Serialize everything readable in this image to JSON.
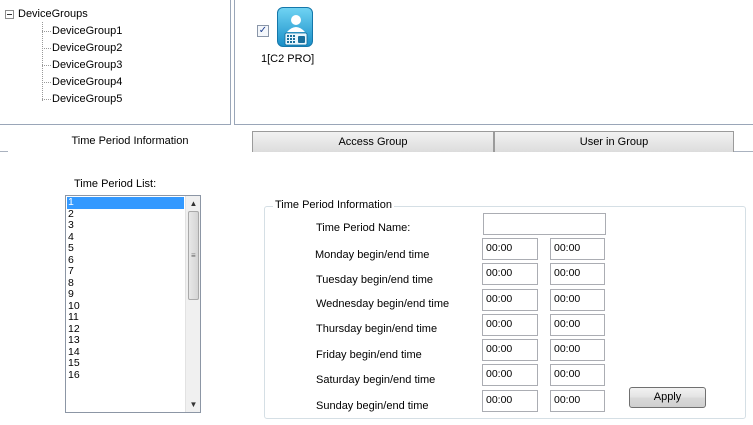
{
  "tree": {
    "root": "DeviceGroups",
    "items": [
      "DeviceGroup1",
      "DeviceGroup2",
      "DeviceGroup3",
      "DeviceGroup4",
      "DeviceGroup5"
    ]
  },
  "device": {
    "label": "1[C2 PRO]",
    "checked": true,
    "icon": "device-terminal-icon"
  },
  "tabs": [
    "Time Period Information",
    "Access Group",
    "User in Group"
  ],
  "time_period_list": {
    "title": "Time Period List:",
    "items": [
      "1",
      "2",
      "3",
      "4",
      "5",
      "6",
      "7",
      "8",
      "9",
      "10",
      "11",
      "12",
      "13",
      "14",
      "15",
      "16"
    ],
    "selected": "1"
  },
  "info": {
    "group_title": "Time Period Information",
    "name_label": "Time Period Name:",
    "name_value": "",
    "days": [
      {
        "label": "Monday begin/end time",
        "begin": "00:00",
        "end": "00:00"
      },
      {
        "label": "Tuesday begin/end time",
        "begin": "00:00",
        "end": "00:00"
      },
      {
        "label": "Wednesday begin/end time",
        "begin": "00:00",
        "end": "00:00"
      },
      {
        "label": "Thursday begin/end time",
        "begin": "00:00",
        "end": "00:00"
      },
      {
        "label": "Friday begin/end time",
        "begin": "00:00",
        "end": "00:00"
      },
      {
        "label": "Saturday begin/end time",
        "begin": "00:00",
        "end": "00:00"
      },
      {
        "label": "Sunday begin/end time",
        "begin": "00:00",
        "end": "00:00"
      }
    ],
    "apply_label": "Apply"
  },
  "colors": {
    "selection": "#3399ff",
    "device_icon": "#1a8fc8"
  }
}
